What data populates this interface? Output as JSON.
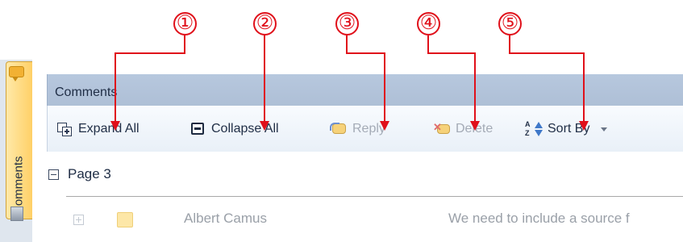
{
  "callouts": [
    "①",
    "②",
    "③",
    "④",
    "⑤"
  ],
  "rail": {
    "comments_tab_label": "Comments",
    "comments_tab_icon": "comment-bubble-icon",
    "second_icon": "pages-icon"
  },
  "panel": {
    "title": "Comments"
  },
  "toolbar": {
    "expand_all": {
      "label": "Expand All",
      "icon": "expand-all-icon",
      "enabled": true
    },
    "collapse_all": {
      "label": "Collapse All",
      "icon": "collapse-all-icon",
      "enabled": true
    },
    "reply": {
      "label": "Reply",
      "icon": "reply-icon",
      "enabled": false
    },
    "delete": {
      "label": "Delete",
      "icon": "delete-icon",
      "enabled": false
    },
    "sort_by": {
      "label": "Sort By",
      "icon": "sort-icon",
      "enabled": true,
      "has_dropdown": true
    }
  },
  "groups": [
    {
      "label": "Page 3",
      "expanded": true,
      "comments": [
        {
          "author": "Albert Camus",
          "text": "We need to include a source f"
        }
      ]
    }
  ],
  "colors": {
    "callout": "#e0101a",
    "header": "#b7c8de",
    "toolbar": "#eef3f9",
    "tab_active": "#ffd067"
  }
}
